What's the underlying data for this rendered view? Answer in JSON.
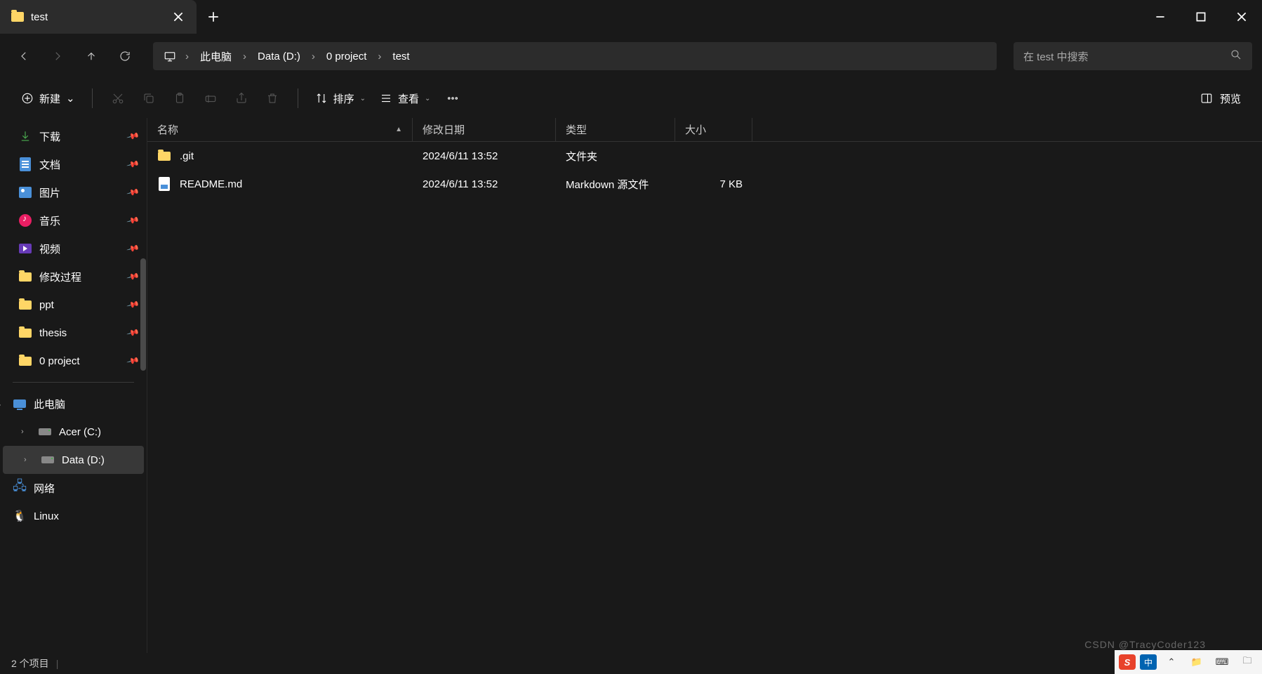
{
  "tab": {
    "title": "test"
  },
  "breadcrumb": [
    {
      "label": "此电脑"
    },
    {
      "label": "Data (D:)"
    },
    {
      "label": "0 project"
    },
    {
      "label": "test"
    }
  ],
  "search": {
    "placeholder": "在 test 中搜索"
  },
  "toolbar": {
    "new_label": "新建",
    "sort_label": "排序",
    "view_label": "查看",
    "preview_label": "预览"
  },
  "sidebar": {
    "quick": [
      {
        "icon": "download",
        "label": "下载",
        "pinned": true
      },
      {
        "icon": "doc",
        "label": "文档",
        "pinned": true
      },
      {
        "icon": "pic",
        "label": "图片",
        "pinned": true
      },
      {
        "icon": "music",
        "label": "音乐",
        "pinned": true
      },
      {
        "icon": "video",
        "label": "视频",
        "pinned": true
      },
      {
        "icon": "folder",
        "label": "修改过程",
        "pinned": true
      },
      {
        "icon": "folder",
        "label": "ppt",
        "pinned": true
      },
      {
        "icon": "folder",
        "label": "thesis",
        "pinned": true
      },
      {
        "icon": "folder",
        "label": "0 project",
        "pinned": true
      }
    ],
    "this_pc_label": "此电脑",
    "drives": [
      {
        "label": "Acer (C:)"
      },
      {
        "label": "Data (D:)",
        "selected": true
      }
    ],
    "network_label": "网络",
    "linux_label": "Linux"
  },
  "columns": {
    "name": "名称",
    "date": "修改日期",
    "type": "类型",
    "size": "大小"
  },
  "files": [
    {
      "icon": "folder",
      "name": ".git",
      "date": "2024/6/11 13:52",
      "type": "文件夹",
      "size": ""
    },
    {
      "icon": "md",
      "name": "README.md",
      "date": "2024/6/11 13:52",
      "type": "Markdown 源文件",
      "size": "7 KB"
    }
  ],
  "status": {
    "count": "2 个项目"
  },
  "watermark": "CSDN @TracyCoder123",
  "tray": {
    "ime": "中"
  }
}
